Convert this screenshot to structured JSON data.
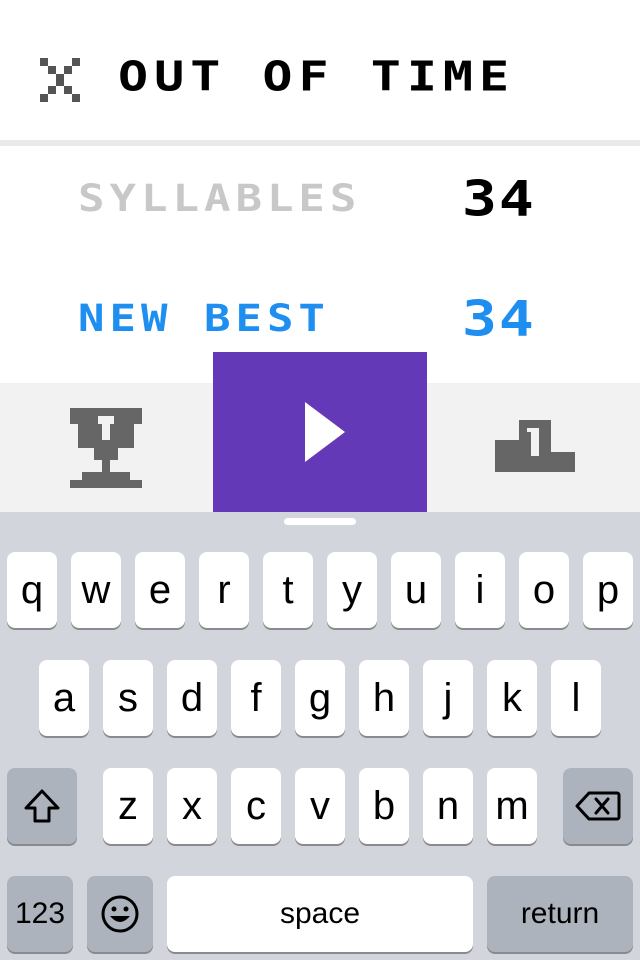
{
  "header": {
    "title": "OUT OF TIME",
    "close_icon": "close-x-icon"
  },
  "stats": {
    "syllables_label": "SYLLABLES",
    "syllables_value": "34",
    "best_label": "NEW BEST",
    "best_value": "34"
  },
  "actions": {
    "left_icon": "trophy-icon",
    "center_icon": "play-icon",
    "right_icon": "podium-icon"
  },
  "keyboard": {
    "row1": [
      "q",
      "w",
      "e",
      "r",
      "t",
      "y",
      "u",
      "i",
      "o",
      "p"
    ],
    "row2": [
      "a",
      "s",
      "d",
      "f",
      "g",
      "h",
      "j",
      "k",
      "l"
    ],
    "row3": [
      "z",
      "x",
      "c",
      "v",
      "b",
      "n",
      "m"
    ],
    "numbers_label": "123",
    "space_label": "space",
    "return_label": "return"
  },
  "colors": {
    "play_button": "#6339b7",
    "best_blue": "#1e8ff0",
    "syllables_grey": "#c8c8c8",
    "keyboard_bg": "#d2d5db"
  }
}
